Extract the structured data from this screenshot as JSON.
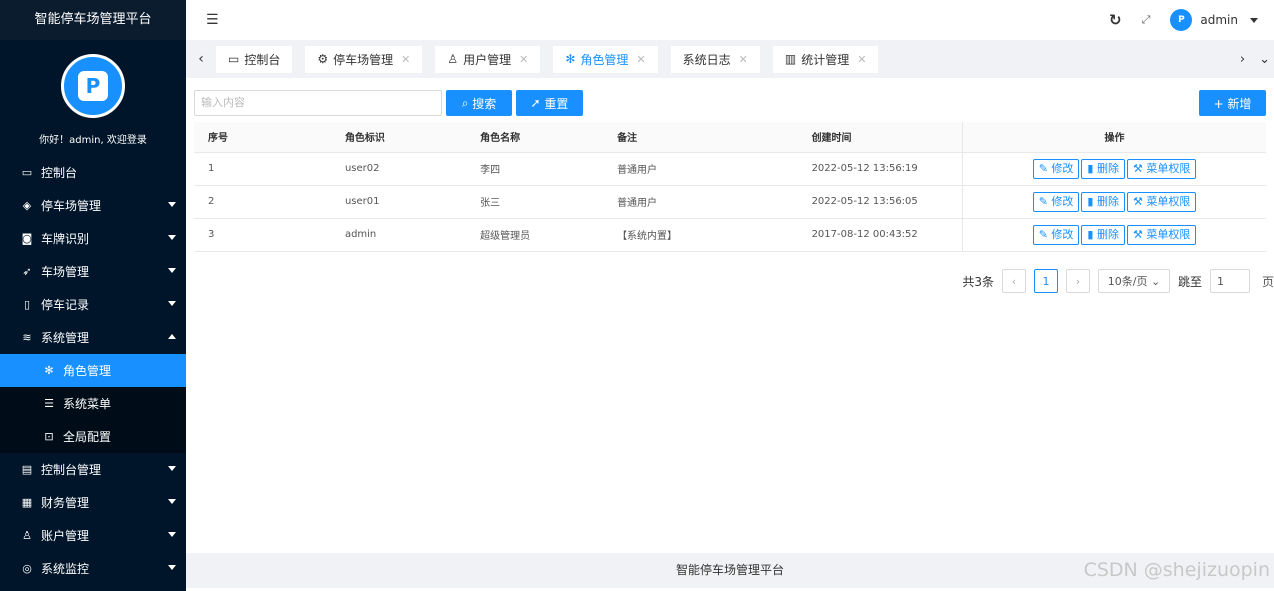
{
  "app": {
    "title": "智能停车场管理平台",
    "welcome": "你好！admin, 欢迎登录",
    "user": "admin",
    "avatar_text": "P"
  },
  "menu": [
    {
      "label": "控制台",
      "icon": "monitor-icon",
      "arrow": ""
    },
    {
      "label": "停车场管理",
      "icon": "gem-icon",
      "arrow": "down"
    },
    {
      "label": "车牌识别",
      "icon": "camera-icon",
      "arrow": "down"
    },
    {
      "label": "车场管理",
      "icon": "send-icon",
      "arrow": "down"
    },
    {
      "label": "停车记录",
      "icon": "tablet-icon",
      "arrow": "down"
    },
    {
      "label": "系统管理",
      "icon": "layers-icon",
      "arrow": "up"
    }
  ],
  "submenu": [
    {
      "label": "角色管理",
      "icon": "snowflake-icon",
      "active": true
    },
    {
      "label": "系统菜单",
      "icon": "list-icon",
      "active": false
    },
    {
      "label": "全局配置",
      "icon": "config-icon",
      "active": false
    }
  ],
  "menu2": [
    {
      "label": "控制台管理",
      "icon": "doc-icon"
    },
    {
      "label": "财务管理",
      "icon": "appstore-icon"
    },
    {
      "label": "账户管理",
      "icon": "user-icon"
    },
    {
      "label": "系统监控",
      "icon": "camera2-icon"
    }
  ],
  "tabs": [
    {
      "label": "控制台",
      "icon": "monitor-icon",
      "closable": false,
      "active": false
    },
    {
      "label": "停车场管理",
      "icon": "gear-icon",
      "closable": true,
      "active": false
    },
    {
      "label": "用户管理",
      "icon": "user-icon",
      "closable": true,
      "active": false
    },
    {
      "label": "角色管理",
      "icon": "snowflake-icon",
      "closable": true,
      "active": true
    },
    {
      "label": "系统日志",
      "icon": "",
      "closable": true,
      "active": false
    },
    {
      "label": "统计管理",
      "icon": "chart-icon",
      "closable": true,
      "active": false
    }
  ],
  "search": {
    "placeholder": "输入内容",
    "search_label": "搜索",
    "reset_label": "重置",
    "add_label": "+ 新增"
  },
  "table": {
    "headers": [
      "序号",
      "角色标识",
      "角色名称",
      "备注",
      "创建时间",
      "操作"
    ],
    "rows": [
      [
        "1",
        "user02",
        "李四",
        "普通用户",
        "2022-05-12 13:56:19"
      ],
      [
        "2",
        "user01",
        "张三",
        "普通用户",
        "2022-05-12 13:56:05"
      ],
      [
        "3",
        "admin",
        "超级管理员",
        "【系统内置】",
        "2017-08-12 00:43:52"
      ]
    ],
    "actions": {
      "edit": "修改",
      "delete": "删除",
      "perm": "菜单权限"
    }
  },
  "pager": {
    "total": "共3条",
    "current": "1",
    "size": "10条/页",
    "jump": "跳至",
    "jump_value": "1",
    "page_suffix": "页"
  },
  "footer": {
    "text": "智能停车场管理平台",
    "watermark": "CSDN @shejizuopin"
  }
}
